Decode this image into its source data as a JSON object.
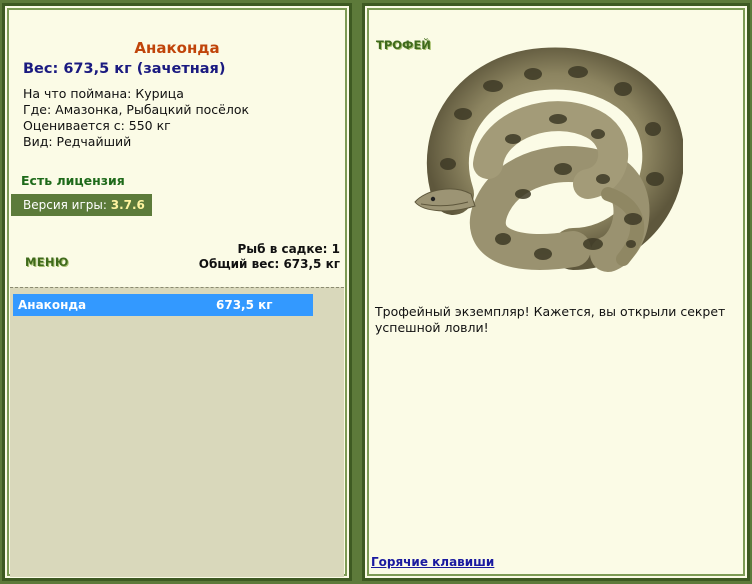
{
  "fish": {
    "name": "Анаконда",
    "weight": "Вес: 673,5 кг (зачетная)",
    "bait": "На что поймана: Курица",
    "location": "Где: Амазонка, Рыбацкий посёлок",
    "value": "Оценивается с: 550 кг",
    "rarity": "Вид: Редчайший"
  },
  "license": "Есть лицензия",
  "version": {
    "label": "Версия игры:",
    "number": "3.7.6"
  },
  "menu_label": "МЕНЮ",
  "stats": {
    "fish_count": "Рыб в садке: 1",
    "total_weight": "Общий вес: 673,5 кг"
  },
  "catch_list": [
    {
      "name": "Анаконда",
      "weight": "673,5 кг"
    }
  ],
  "trophy": {
    "label": "ТРОФЕЙ",
    "text": "Трофейный экземпляр! Кажется, вы открыли секрет успешной ловли!"
  },
  "hotkeys_link": "Горячие клавиши",
  "colors": {
    "frame": "#5d7a3a",
    "panel_bg": "#fbfbe6",
    "title_orange": "#c0440a",
    "weight_navy": "#1a1a80",
    "selection_blue": "#3399ff"
  }
}
